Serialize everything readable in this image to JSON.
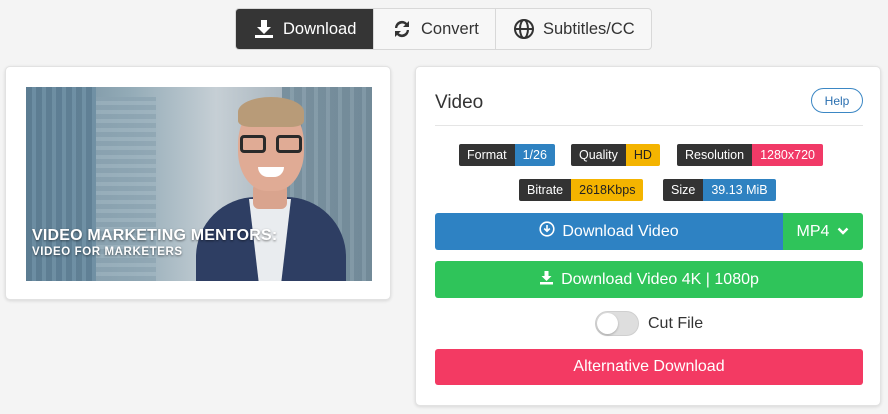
{
  "tabs": [
    {
      "label": "Download",
      "icon": "download-icon",
      "active": true
    },
    {
      "label": "Convert",
      "icon": "convert-icon",
      "active": false
    },
    {
      "label": "Subtitles/CC",
      "icon": "globe-icon",
      "active": false
    }
  ],
  "thumbnail": {
    "caption_line1": "VIDEO MARKETING MENTORS:",
    "caption_line2": "VIDEO FOR MARKETERS"
  },
  "panel": {
    "title": "Video",
    "help_label": "Help",
    "badges": {
      "format": {
        "key": "Format",
        "value": "1/26",
        "color": "#2f82c1"
      },
      "quality": {
        "key": "Quality",
        "value": "HD",
        "color": "#f4b400"
      },
      "resolution": {
        "key": "Resolution",
        "value": "1280x720",
        "color": "#f13a67"
      },
      "bitrate": {
        "key": "Bitrate",
        "value": "2618Kbps",
        "color": "#f4b400"
      },
      "size": {
        "key": "Size",
        "value": "39.13 MiB",
        "color": "#2f82c1"
      }
    },
    "download_video_label": "Download Video",
    "format_select_value": "MP4",
    "download_4k_label": "Download Video 4K | 1080p",
    "cut_file_label": "Cut File",
    "cut_file_enabled": false,
    "alt_download_label": "Alternative Download"
  },
  "colors": {
    "blue": "#2e82c3",
    "green": "#2fc45a",
    "pink": "#f33a63",
    "dark": "#353535"
  }
}
